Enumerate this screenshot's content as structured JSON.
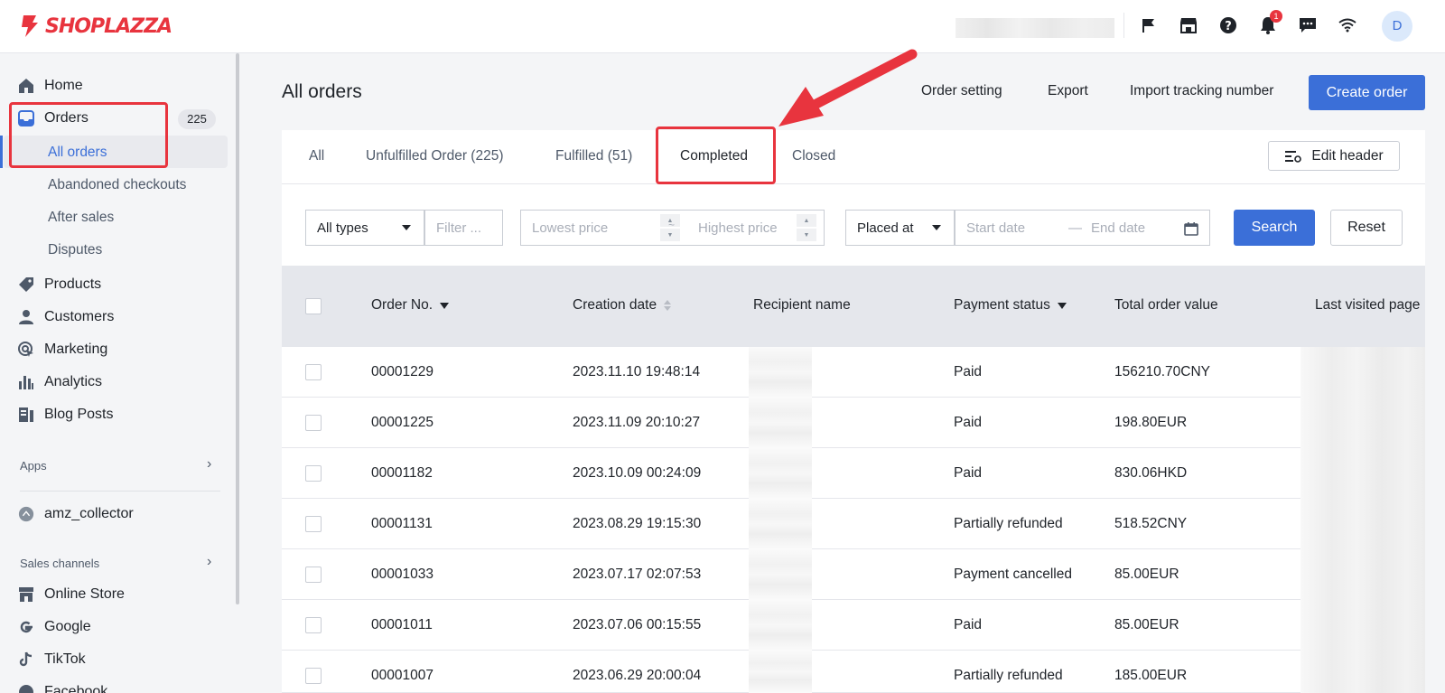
{
  "brand": {
    "name": "SHOPLAZZA",
    "accent": "#3b6fd8",
    "logo_color": "#e8343e"
  },
  "header": {
    "icons": [
      "flag-icon",
      "store-icon",
      "help-icon",
      "bell-icon",
      "chat-icon",
      "wifi-icon"
    ],
    "notification_count": "1",
    "avatar_initial": "D"
  },
  "sidebar": {
    "home": "Home",
    "orders": "Orders",
    "orders_count": "225",
    "orders_sub": [
      "All orders",
      "Abandoned checkouts",
      "After sales",
      "Disputes"
    ],
    "products": "Products",
    "customers": "Customers",
    "marketing": "Marketing",
    "analytics": "Analytics",
    "blog_posts": "Blog Posts",
    "apps_label": "Apps",
    "app_item": "amz_collector",
    "sales_channels_label": "Sales channels",
    "channels": [
      "Online Store",
      "Google",
      "TikTok",
      "Facebook"
    ]
  },
  "main": {
    "title": "All orders",
    "actions": {
      "order_setting": "Order setting",
      "export": "Export",
      "import_tracking": "Import tracking number",
      "create_order": "Create order"
    },
    "tabs": [
      "All",
      "Unfulfilled Order (225)",
      "Fulfilled (51)",
      "Completed",
      "Closed"
    ],
    "active_tab": "Completed",
    "edit_header": "Edit header",
    "filters": {
      "type_select": "All types",
      "filter_placeholder": "Filter ...",
      "lowest_price": "Lowest price",
      "range_sep": "~",
      "highest_price": "Highest price",
      "date_type": "Placed at",
      "start_date": "Start date",
      "date_sep": "—",
      "end_date": "End date",
      "search": "Search",
      "reset": "Reset"
    },
    "columns": [
      "Order No.",
      "Creation date",
      "Recipient name",
      "Payment status",
      "Total order value",
      "Last visited page"
    ],
    "rows": [
      {
        "order_no": "00001229",
        "date": "2023.11.10 19:48:14",
        "payment": "Paid",
        "total": "156210.70CNY"
      },
      {
        "order_no": "00001225",
        "date": "2023.11.09 20:10:27",
        "payment": "Paid",
        "total": "198.80EUR"
      },
      {
        "order_no": "00001182",
        "date": "2023.10.09 00:24:09",
        "payment": "Paid",
        "total": "830.06HKD"
      },
      {
        "order_no": "00001131",
        "date": "2023.08.29 19:15:30",
        "payment": "Partially refunded",
        "total": "518.52CNY"
      },
      {
        "order_no": "00001033",
        "date": "2023.07.17 02:07:53",
        "payment": "Payment cancelled",
        "total": "85.00EUR"
      },
      {
        "order_no": "00001011",
        "date": "2023.07.06 00:15:55",
        "payment": "Paid",
        "total": "85.00EUR"
      },
      {
        "order_no": "00001007",
        "date": "2023.06.29 20:00:04",
        "payment": "Partially refunded",
        "total": "185.00EUR"
      }
    ]
  }
}
